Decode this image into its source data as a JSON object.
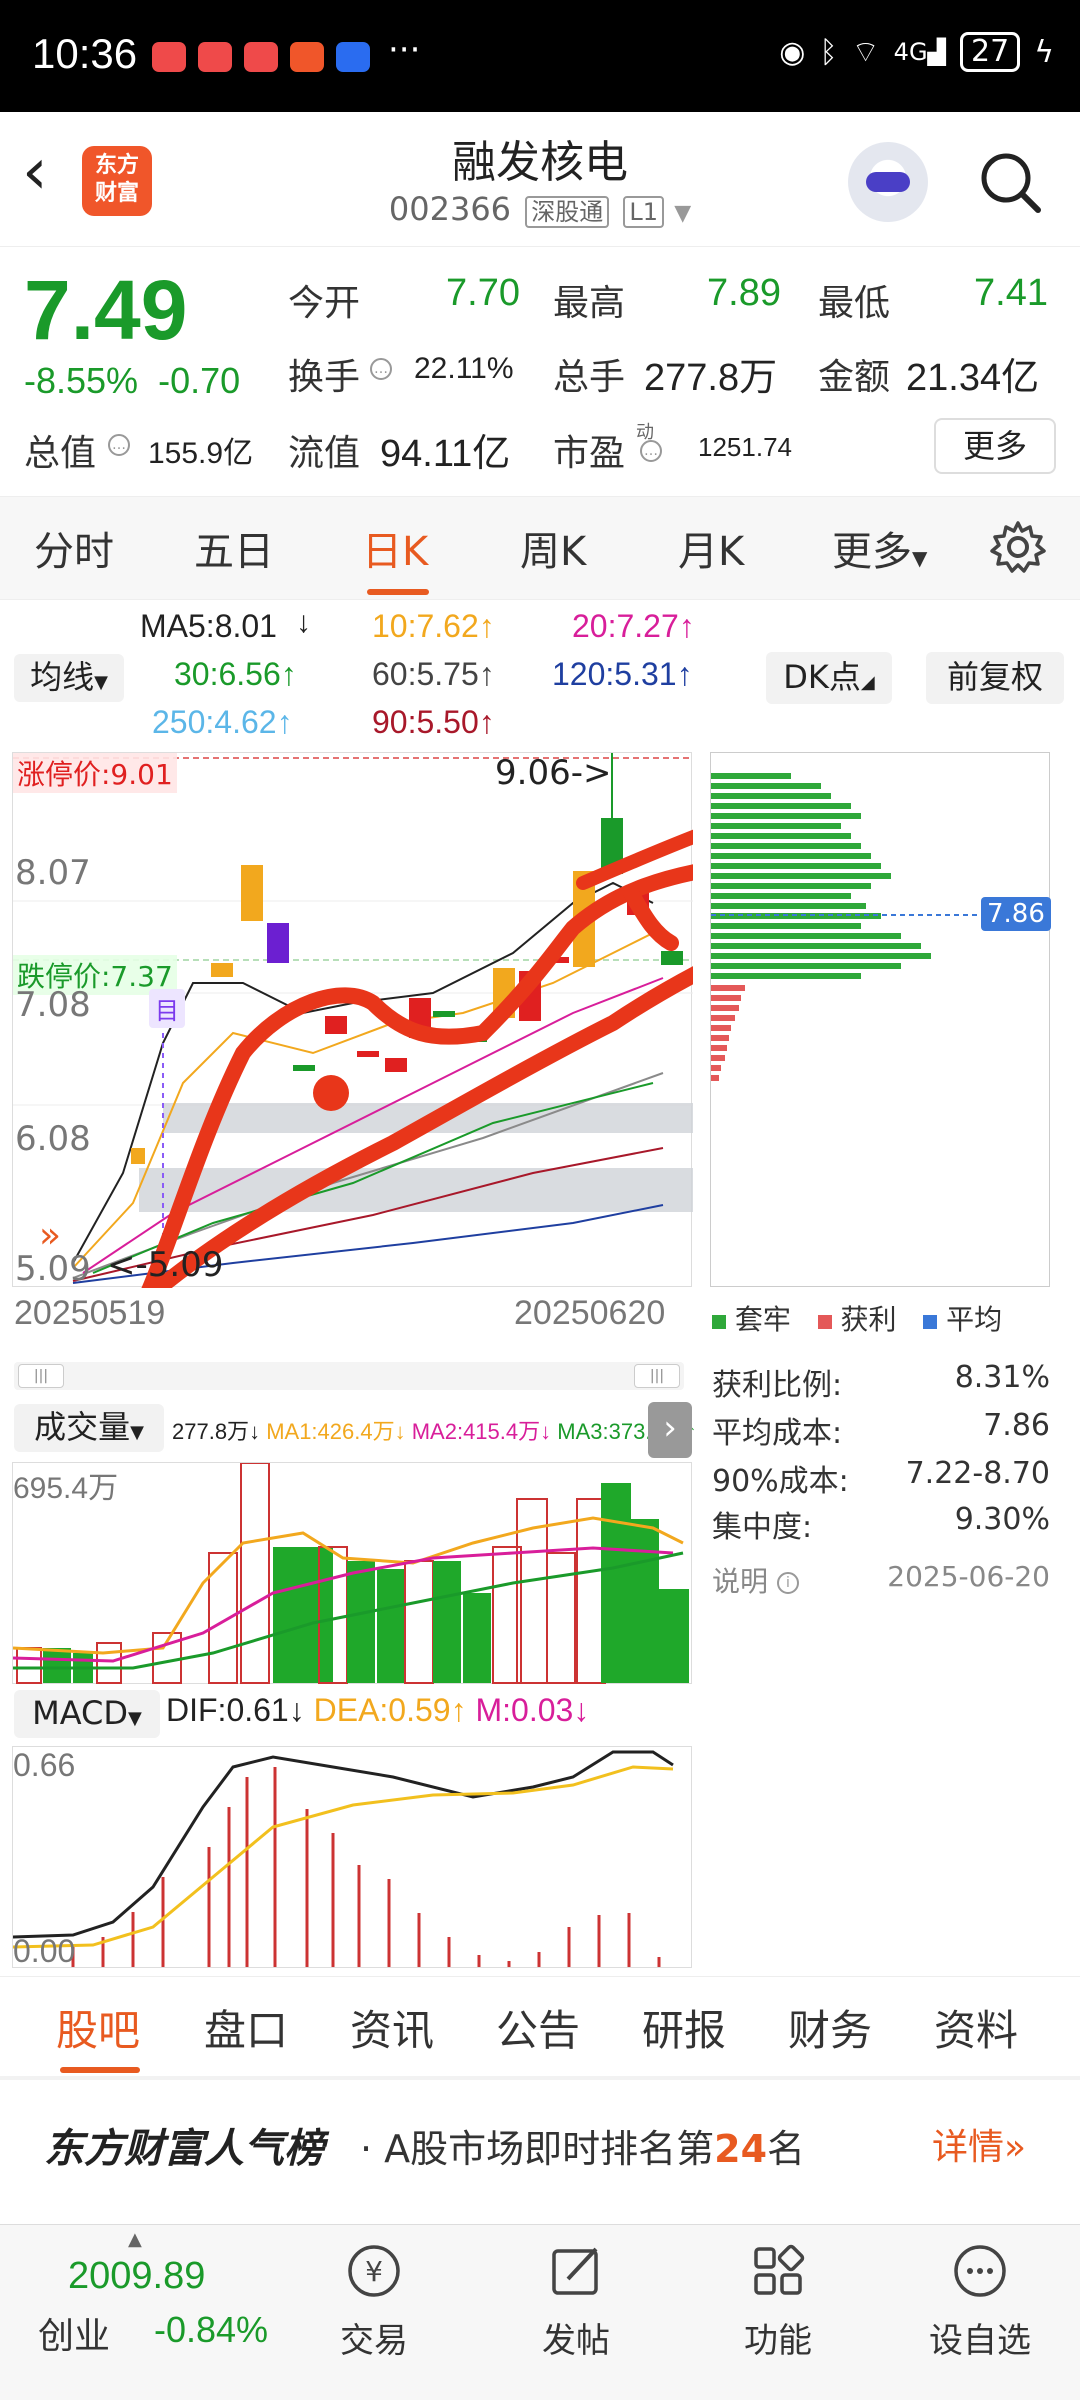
{
  "status_bar": {
    "time": "10:36",
    "battery": "27",
    "network": "4G"
  },
  "header": {
    "title": "融发核电",
    "code": "002366",
    "market_tag": "深股通",
    "level_tag": "L1",
    "logo_text": "东方财富"
  },
  "quote": {
    "price": "7.49",
    "change_pct": "-8.55%",
    "change": "-0.70",
    "open_label": "今开",
    "open": "7.70",
    "high_label": "最高",
    "high": "7.89",
    "low_label": "最低",
    "low": "7.41",
    "turnover_label": "换手",
    "turnover": "22.11%",
    "volume_label": "总手",
    "volume": "277.8万",
    "amount_label": "金额",
    "amount": "21.34亿",
    "mktcap_label": "总值",
    "mktcap": "155.9亿",
    "float_label": "流值",
    "float_cap": "94.11亿",
    "pe_label": "市盈",
    "pe_sup": "动",
    "pe": "1251.74",
    "more_label": "更多"
  },
  "chart_tabs": [
    "分时",
    "五日",
    "日K",
    "周K",
    "月K",
    "更多"
  ],
  "active_chart_tab": "日K",
  "ma_legend": {
    "selector": "均线",
    "ma5": "MA5:8.01",
    "ma10": "10:7.62",
    "ma20": "20:7.27",
    "ma30": "30:6.56",
    "ma60": "60:5.75",
    "ma120": "120:5.31",
    "ma250": "250:4.62",
    "ma90": "90:5.50",
    "dk_button": "DK点",
    "fq_button": "前复权"
  },
  "kline": {
    "limit_up": "涨停价:9.01",
    "limit_down": "跌停价:7.37",
    "y_labels": [
      "8.07",
      "7.08",
      "6.08",
      "5.09"
    ],
    "high_annot": "9.06->",
    "low_annot": "<-5.09",
    "date_start": "20250519",
    "date_end": "20250620",
    "badge": "目"
  },
  "chips": {
    "current_price_tag": "7.86",
    "legend": [
      "套牢",
      "获利",
      "平均"
    ],
    "profit_ratio_label": "获利比例:",
    "profit_ratio": "8.31%",
    "avg_cost_label": "平均成本:",
    "avg_cost": "7.86",
    "cost90_label": "90%成本:",
    "cost90": "7.22-8.70",
    "concentration_label": "集中度:",
    "concentration": "9.30%",
    "note_label": "说明",
    "date": "2025-06-20"
  },
  "volume": {
    "selector": "成交量",
    "legend": "277.8万",
    "ma1": "MA1:426.4万",
    "ma2": "MA2:415.4万",
    "ma3": "MA3:373.8万",
    "y_max": "695.4万"
  },
  "macd": {
    "selector": "MACD",
    "dif": "DIF:0.61",
    "dea": "DEA:0.59",
    "m": "M:0.03",
    "y_top": "0.66",
    "y_bottom": "0.00"
  },
  "bottom_tabs": [
    "股吧",
    "盘口",
    "资讯",
    "公告",
    "研报",
    "财务",
    "资料"
  ],
  "rank": {
    "brand": "东方财富人气榜",
    "text_pre": "· A股市场即时排名第",
    "rank_no": "24",
    "text_post": "名",
    "detail": "详情"
  },
  "footer": {
    "index_value": "2009.89",
    "index_name": "创业",
    "index_change": "-0.84%",
    "items": [
      "交易",
      "发帖",
      "功能",
      "设自选"
    ]
  },
  "colors": {
    "up": "#e02020",
    "down": "#1a9a2a",
    "accent": "#e85a20"
  }
}
